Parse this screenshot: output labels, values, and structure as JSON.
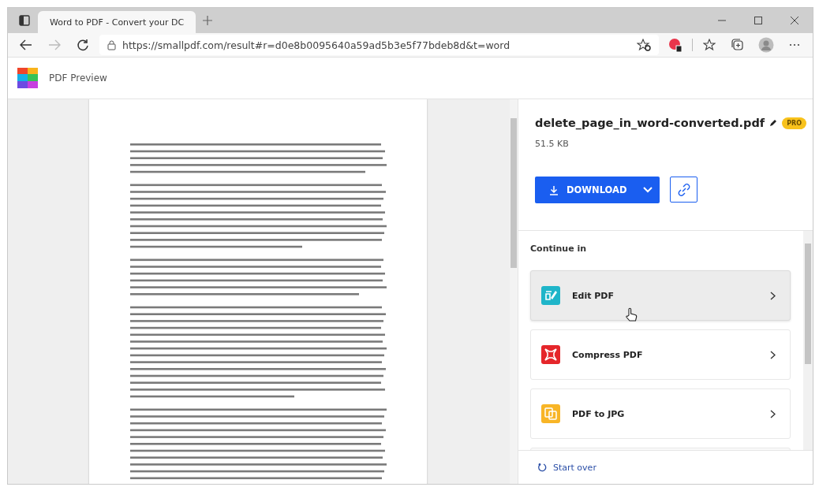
{
  "browser": {
    "tab": {
      "title": "Word to PDF - Convert your DC",
      "selected": true
    },
    "url": "https://smallpdf.com/result#r=d0e8b0095640a59ad5b3e5f77bdeb8d&t=word"
  },
  "app": {
    "title": "PDF Preview"
  },
  "file": {
    "name": "delete_page_in_word-converted.pdf",
    "badge": "PRO",
    "size": "51.5 KB",
    "download_label": "DOWNLOAD"
  },
  "continue": {
    "heading": "Continue in",
    "tools": [
      {
        "label": "Edit PDF",
        "color": "#1fb5c9",
        "kind": "edit",
        "hovered": true
      },
      {
        "label": "Compress PDF",
        "color": "#e5262b",
        "kind": "compress",
        "hovered": false
      },
      {
        "label": "PDF to JPG",
        "color": "#f8b526",
        "kind": "jpg",
        "hovered": false
      }
    ]
  },
  "footer": {
    "start_over": "Start over"
  }
}
